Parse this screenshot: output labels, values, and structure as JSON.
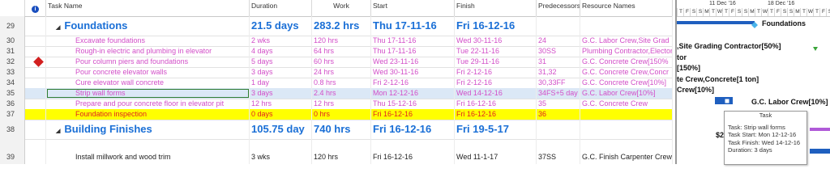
{
  "columns": {
    "info": "i",
    "task_name": "Task Name",
    "duration": "Duration",
    "work": "Work",
    "start": "Start",
    "finish": "Finish",
    "predecessors": "Predecessors",
    "resource_names": "Resource Names"
  },
  "rows": [
    {
      "id": "29",
      "name": "Foundations",
      "duration": "21.5 days",
      "work": "283.2 hrs",
      "start": "Thu 17-11-16",
      "finish": "Fri 16-12-16",
      "pred": "",
      "res": ""
    },
    {
      "id": "30",
      "name": "Excavate foundations",
      "duration": "2 wks",
      "work": "120 hrs",
      "start": "Thu 17-11-16",
      "finish": "Wed 30-11-16",
      "pred": "24",
      "res": "G.C. Labor Crew,Site Grad"
    },
    {
      "id": "31",
      "name": "Rough-in electric and plumbing in elevator",
      "duration": "4 days",
      "work": "64 hrs",
      "start": "Thu 17-11-16",
      "finish": "Tue 22-11-16",
      "pred": "30SS",
      "res": "Plumbing Contractor,Elector"
    },
    {
      "id": "32",
      "name": "Pour column piers and foundations",
      "duration": "5 days",
      "work": "60 hrs",
      "start": "Wed 23-11-16",
      "finish": "Tue 29-11-16",
      "pred": "31",
      "res": "G.C. Concrete Crew[150%"
    },
    {
      "id": "33",
      "name": "Pour concrete elevator walls",
      "duration": "3 days",
      "work": "24 hrs",
      "start": "Wed 30-11-16",
      "finish": "Fri 2-12-16",
      "pred": "31,32",
      "res": "G.C. Concrete Crew,Concr"
    },
    {
      "id": "34",
      "name": "Cure elevator wall concrete",
      "duration": "1 day",
      "work": "0.8 hrs",
      "start": "Fri 2-12-16",
      "finish": "Fri 2-12-16",
      "pred": "30,33FF",
      "res": "G.C. Concrete Crew[10%]"
    },
    {
      "id": "35",
      "name": "Strip wall forms",
      "duration": "3 days",
      "work": "2.4 hrs",
      "start": "Mon 12-12-16",
      "finish": "Wed 14-12-16",
      "pred": "34FS+5 day",
      "res": "G.C. Labor Crew[10%]"
    },
    {
      "id": "36",
      "name": "Prepare and pour concrete floor in elevator pit",
      "duration": "12 hrs",
      "work": "12 hrs",
      "start": "Thu 15-12-16",
      "finish": "Fri 16-12-16",
      "pred": "35",
      "res": "G.C. Concrete Crew"
    },
    {
      "id": "37",
      "name": "Foundation inspection",
      "duration": "0 days",
      "work": "0 hrs",
      "start": "Fri 16-12-16",
      "finish": "Fri 16-12-16",
      "pred": "36",
      "res": ""
    },
    {
      "id": "38",
      "name": "Building Finishes",
      "duration": "105.75 day",
      "work": "740 hrs",
      "start": "Fri 16-12-16",
      "finish": "Fri 19-5-17",
      "pred": "",
      "res": ""
    },
    {
      "id": "39",
      "name": "Install millwork and wood trim",
      "duration": "3 wks",
      "work": "120 hrs",
      "start": "Fri 16-12-16",
      "finish": "Wed 11-1-17",
      "pred": "37SS",
      "res": "G.C. Finish Carpenter Crew"
    }
  ],
  "timeline": {
    "week1": "11 Dec '16",
    "week2": "18 Dec '16",
    "days": [
      "T",
      "F",
      "S",
      "S",
      "M",
      "T",
      "W",
      "T",
      "F",
      "S",
      "S",
      "M",
      "T",
      "W",
      "T",
      "F",
      "S",
      "S",
      "M",
      "T",
      "W",
      "T",
      "F",
      "S"
    ]
  },
  "gantt_labels": {
    "r29": "Foundations",
    "r30": ",Site Grading Contractor[50%]",
    "r31": "tor",
    "r32": "[150%]",
    "r33": "te Crew,Concrete[1 ton]",
    "r34": "Crew[10%]",
    "r35": "G.C. Labor Crew[10%]",
    "r38": "$2"
  },
  "tooltip": {
    "title": "Task",
    "task": "Task:  Strip wall forms",
    "start": "Task Start: Mon 12-12-16",
    "finish": "Task Finish: Wed 14-12-16",
    "duration": "Duration: 3 days"
  },
  "colors": {
    "summary_text": "#1a6fd6",
    "noncritical_text": "#d24ec8",
    "milestone_fill": "#ffff00",
    "milestone_text": "#e02020",
    "bar_blue": "#1f5fbf",
    "bar_purple": "#b05ad8"
  }
}
